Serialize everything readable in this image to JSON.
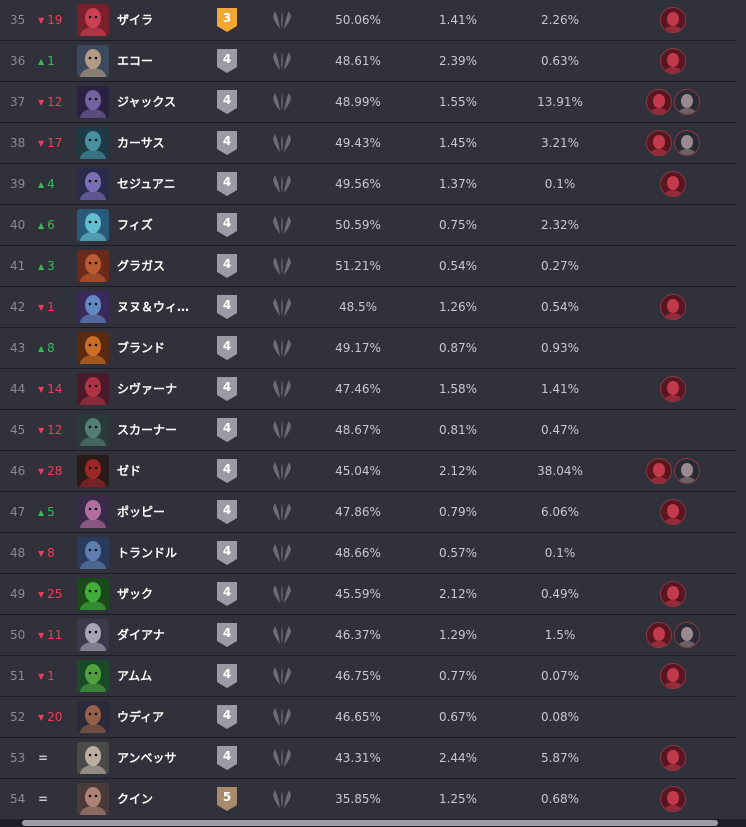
{
  "colors": {
    "background": "#31313c",
    "divider": "#1c1c24",
    "rank_down": "#e84057",
    "rank_up": "#3db85b",
    "tier_3": "#f0a830",
    "tier_4": "#9b9ba6",
    "tier_5": "#a88a6c"
  },
  "rows": [
    {
      "rank": "35",
      "dir": "down",
      "change": "19",
      "name": "ザイラ",
      "tier": "3",
      "winrate": "50.06%",
      "pickrate": "1.41%",
      "banrate": "2.26%",
      "counters": [
        "counter-champion-1"
      ],
      "avatar": "zyra-portrait-icon"
    },
    {
      "rank": "36",
      "dir": "up",
      "change": "1",
      "name": "エコー",
      "tier": "4",
      "winrate": "48.61%",
      "pickrate": "2.39%",
      "banrate": "0.63%",
      "counters": [
        "counter-champion-1"
      ],
      "avatar": "ekko-portrait-icon"
    },
    {
      "rank": "37",
      "dir": "down",
      "change": "12",
      "name": "ジャックス",
      "tier": "4",
      "winrate": "48.99%",
      "pickrate": "1.55%",
      "banrate": "13.91%",
      "counters": [
        "counter-champion-1",
        "counter-champion-2"
      ],
      "avatar": "jax-portrait-icon"
    },
    {
      "rank": "38",
      "dir": "down",
      "change": "17",
      "name": "カーサス",
      "tier": "4",
      "winrate": "49.43%",
      "pickrate": "1.45%",
      "banrate": "3.21%",
      "counters": [
        "counter-champion-1",
        "counter-champion-2"
      ],
      "avatar": "karthus-portrait-icon"
    },
    {
      "rank": "39",
      "dir": "up",
      "change": "4",
      "name": "セジュアニ",
      "tier": "4",
      "winrate": "49.56%",
      "pickrate": "1.37%",
      "banrate": "0.1%",
      "counters": [
        "counter-champion-1"
      ],
      "avatar": "sejuani-portrait-icon"
    },
    {
      "rank": "40",
      "dir": "up",
      "change": "6",
      "name": "フィズ",
      "tier": "4",
      "winrate": "50.59%",
      "pickrate": "0.75%",
      "banrate": "2.32%",
      "counters": [],
      "avatar": "fizz-portrait-icon"
    },
    {
      "rank": "41",
      "dir": "up",
      "change": "3",
      "name": "グラガス",
      "tier": "4",
      "winrate": "51.21%",
      "pickrate": "0.54%",
      "banrate": "0.27%",
      "counters": [],
      "avatar": "gragas-portrait-icon"
    },
    {
      "rank": "42",
      "dir": "down",
      "change": "1",
      "name": "ヌヌ＆ウィ…",
      "tier": "4",
      "winrate": "48.5%",
      "pickrate": "1.26%",
      "banrate": "0.54%",
      "counters": [
        "counter-champion-1"
      ],
      "avatar": "nunu-portrait-icon"
    },
    {
      "rank": "43",
      "dir": "up",
      "change": "8",
      "name": "ブランド",
      "tier": "4",
      "winrate": "49.17%",
      "pickrate": "0.87%",
      "banrate": "0.93%",
      "counters": [],
      "avatar": "brand-portrait-icon"
    },
    {
      "rank": "44",
      "dir": "down",
      "change": "14",
      "name": "シヴァーナ",
      "tier": "4",
      "winrate": "47.46%",
      "pickrate": "1.58%",
      "banrate": "1.41%",
      "counters": [
        "counter-champion-1"
      ],
      "avatar": "shyvana-portrait-icon"
    },
    {
      "rank": "45",
      "dir": "down",
      "change": "12",
      "name": "スカーナー",
      "tier": "4",
      "winrate": "48.67%",
      "pickrate": "0.81%",
      "banrate": "0.47%",
      "counters": [],
      "avatar": "skarner-portrait-icon"
    },
    {
      "rank": "46",
      "dir": "down",
      "change": "28",
      "name": "ゼド",
      "tier": "4",
      "winrate": "45.04%",
      "pickrate": "2.12%",
      "banrate": "38.04%",
      "counters": [
        "counter-champion-1",
        "counter-champion-2"
      ],
      "avatar": "zed-portrait-icon"
    },
    {
      "rank": "47",
      "dir": "up",
      "change": "5",
      "name": "ポッピー",
      "tier": "4",
      "winrate": "47.86%",
      "pickrate": "0.79%",
      "banrate": "6.06%",
      "counters": [
        "counter-champion-1"
      ],
      "avatar": "poppy-portrait-icon"
    },
    {
      "rank": "48",
      "dir": "down",
      "change": "8",
      "name": "トランドル",
      "tier": "4",
      "winrate": "48.66%",
      "pickrate": "0.57%",
      "banrate": "0.1%",
      "counters": [],
      "avatar": "trundle-portrait-icon"
    },
    {
      "rank": "49",
      "dir": "down",
      "change": "25",
      "name": "ザック",
      "tier": "4",
      "winrate": "45.59%",
      "pickrate": "2.12%",
      "banrate": "0.49%",
      "counters": [
        "counter-champion-1"
      ],
      "avatar": "zac-portrait-icon"
    },
    {
      "rank": "50",
      "dir": "down",
      "change": "11",
      "name": "ダイアナ",
      "tier": "4",
      "winrate": "46.37%",
      "pickrate": "1.29%",
      "banrate": "1.5%",
      "counters": [
        "counter-champion-1",
        "counter-champion-2"
      ],
      "avatar": "diana-portrait-icon"
    },
    {
      "rank": "51",
      "dir": "down",
      "change": "1",
      "name": "アムム",
      "tier": "4",
      "winrate": "46.75%",
      "pickrate": "0.77%",
      "banrate": "0.07%",
      "counters": [
        "counter-champion-1"
      ],
      "avatar": "amumu-portrait-icon"
    },
    {
      "rank": "52",
      "dir": "down",
      "change": "20",
      "name": "ウディア",
      "tier": "4",
      "winrate": "46.65%",
      "pickrate": "0.67%",
      "banrate": "0.08%",
      "counters": [],
      "avatar": "udyr-portrait-icon"
    },
    {
      "rank": "53",
      "dir": "eq",
      "change": "=",
      "name": "アンベッサ",
      "tier": "4",
      "winrate": "43.31%",
      "pickrate": "2.44%",
      "banrate": "5.87%",
      "counters": [
        "counter-champion-1"
      ],
      "avatar": "ambessa-portrait-icon"
    },
    {
      "rank": "54",
      "dir": "eq",
      "change": "=",
      "name": "クイン",
      "tier": "5",
      "winrate": "35.85%",
      "pickrate": "1.25%",
      "banrate": "0.68%",
      "counters": [
        "counter-champion-1"
      ],
      "avatar": "quinn-portrait-icon"
    }
  ],
  "role_icon": "jungle-role-icon"
}
